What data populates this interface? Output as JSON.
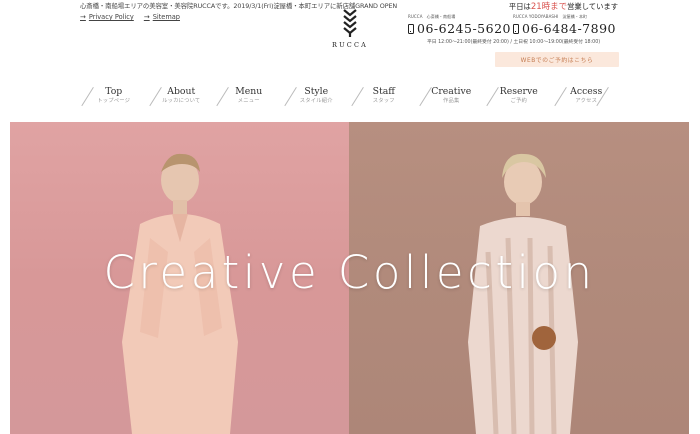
{
  "header": {
    "intro": "心斎橋・南船場エリアの美容室・美容院RUCCAです。2019/3/1(Fri)淀屋橋・本町エリアに新店舗GRAND OPEN",
    "links": [
      {
        "label": "Privacy Policy"
      },
      {
        "label": "Sitemap"
      }
    ],
    "logo_text": "RUCCA",
    "hours_note": {
      "prefix": "平日は",
      "highlight": "21時まで",
      "suffix": "営業しています"
    },
    "tels": [
      {
        "caption": "RUCCA　心斎橋・南船場",
        "number": "06-6245-5620"
      },
      {
        "caption": "RUCCA YODOYABASHI　淀屋橋・本町",
        "number": "06-6484-7890"
      }
    ],
    "tel_hours": [
      "平日 12:00〜21:00(最終受付 20:00) / 土日祝 10:00〜19:00(最終受付 18:00)"
    ],
    "reserve_button": "WEBでのご予約はこちら"
  },
  "nav": {
    "items": [
      {
        "label": "Top",
        "sub": "トップページ"
      },
      {
        "label": "About",
        "sub": "ルッカについて"
      },
      {
        "label": "Menu",
        "sub": "メニュー"
      },
      {
        "label": "Style",
        "sub": "スタイル紹介"
      },
      {
        "label": "Staff",
        "sub": "スタッフ"
      },
      {
        "label": "Creative",
        "sub": "作品集"
      },
      {
        "label": "Reserve",
        "sub": "ご予約"
      },
      {
        "label": "Access",
        "sub": "アクセス"
      }
    ]
  },
  "hero": {
    "title": "Creative Collection",
    "colors": {
      "left_bg": "#d89898",
      "right_bg": "#b18a7b",
      "accent": "#d9534f",
      "reserve_bg": "#fbe8dc"
    }
  }
}
